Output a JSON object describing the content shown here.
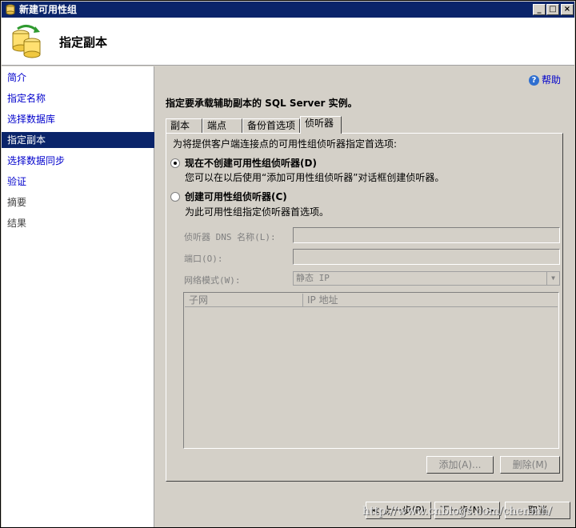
{
  "window": {
    "title": "新建可用性组"
  },
  "header": {
    "heading": "指定副本"
  },
  "sidebar": {
    "items": [
      {
        "label": "简介",
        "state": "link"
      },
      {
        "label": "指定名称",
        "state": "link"
      },
      {
        "label": "选择数据库",
        "state": "link"
      },
      {
        "label": "指定副本",
        "state": "selected"
      },
      {
        "label": "选择数据同步",
        "state": "link"
      },
      {
        "label": "验证",
        "state": "link"
      },
      {
        "label": "摘要",
        "state": "disabled"
      },
      {
        "label": "结果",
        "state": "disabled"
      }
    ]
  },
  "main": {
    "help_label": "帮助",
    "prompt": "指定要承载辅助副本的 SQL Server 实例。",
    "tabs": [
      {
        "label": "副本"
      },
      {
        "label": "端点"
      },
      {
        "label": "备份首选项"
      },
      {
        "label": "侦听器",
        "active": true
      }
    ],
    "listener": {
      "description": "为将提供客户端连接点的可用性组侦听器指定首选项:",
      "option_no": {
        "label": "现在不创建可用性组侦听器(D)",
        "sub": "您可以在以后使用“添加可用性组侦听器”对话框创建侦听器。",
        "checked": true
      },
      "option_create": {
        "label": "创建可用性组侦听器(C)",
        "sub": "为此可用性组指定侦听器首选项。",
        "checked": false
      },
      "dns_label": "侦听器 DNS 名称(L):",
      "dns_value": "",
      "port_label": "端口(O):",
      "port_value": "",
      "network_mode_label": "网络模式(W):",
      "network_mode_value": "静态 IP",
      "grid_columns": [
        "子网",
        "IP 地址"
      ],
      "add_button": "添加(A)...",
      "remove_button": "删除(M)"
    }
  },
  "footer": {
    "prev_button": "< 上一步(P)",
    "next_button": "下一步(N) >",
    "cancel_button": "取消"
  },
  "watermark": "http://www.cnblogs.com/chenmh/"
}
